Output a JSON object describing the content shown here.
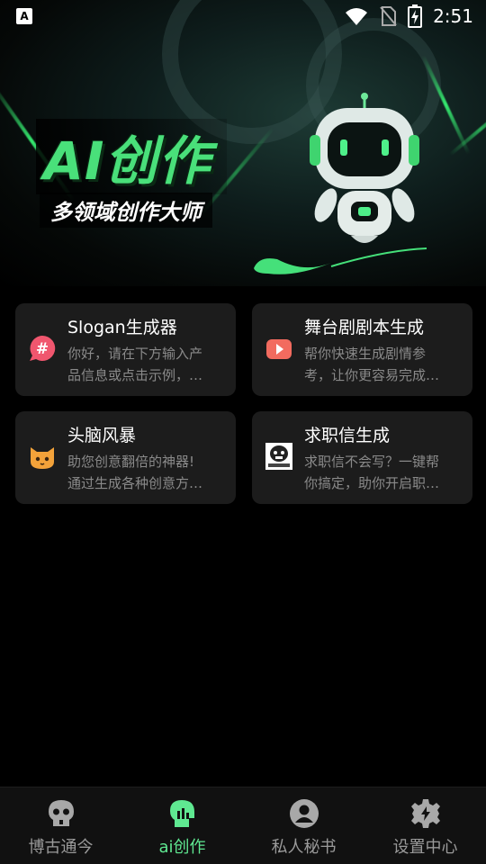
{
  "status_bar": {
    "time": "2:51",
    "left_icon": "A"
  },
  "hero": {
    "title": "AI创作",
    "subtitle": "多领域创作大师"
  },
  "cards": [
    {
      "title": "Slogan生成器",
      "desc_line1": "你好，请在下方输入产",
      "desc_line2": "品信息或点击示例，…",
      "icon": "hash-bubble-icon"
    },
    {
      "title": "舞台剧剧本生成",
      "desc_line1": "帮你快速生成剧情参",
      "desc_line2": "考，让你更容易完成…",
      "icon": "video-play-icon"
    },
    {
      "title": "头脑风暴",
      "desc_line1": "助您创意翻倍的神器!",
      "desc_line2": "通过生成各种创意方…",
      "icon": "cat-face-icon"
    },
    {
      "title": "求职信生成",
      "desc_line1": "求职信不会写？一键帮",
      "desc_line2": "你搞定，助你开启职…",
      "icon": "meme-face-icon"
    }
  ],
  "tabs": [
    {
      "label": "博古通今",
      "icon": "skull-icon",
      "active": false
    },
    {
      "label": "ai创作",
      "icon": "ai-head-icon",
      "active": true
    },
    {
      "label": "私人秘书",
      "icon": "user-circle-icon",
      "active": false
    },
    {
      "label": "设置中心",
      "icon": "gear-icon",
      "active": false
    }
  ],
  "colors": {
    "accent": "#5fe891",
    "card_bg": "#1c1c1c",
    "text_muted": "#8a8a8a"
  }
}
